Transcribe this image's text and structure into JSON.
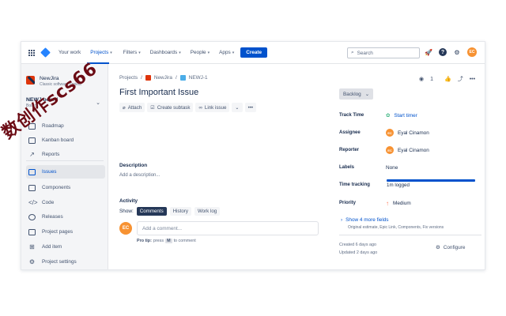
{
  "topnav": {
    "your_work": "Your work",
    "projects": "Projects",
    "filters": "Filters",
    "dashboards": "Dashboards",
    "people": "People",
    "apps": "Apps",
    "create": "Create",
    "search_placeholder": "Search",
    "avatar_initials": "EC"
  },
  "sidebar": {
    "project_name": "NewJira",
    "project_type": "Classic software project",
    "board_name": "NEWJ board",
    "board_type": "Board",
    "items": [
      {
        "label": "Roadmap",
        "icon": "roadmap-icon"
      },
      {
        "label": "Kanban board",
        "icon": "board-icon"
      },
      {
        "label": "Reports",
        "icon": "chart-icon"
      },
      {
        "label": "Issues",
        "icon": "issues-icon"
      },
      {
        "label": "Components",
        "icon": "components-icon"
      },
      {
        "label": "Code",
        "icon": "code-icon"
      },
      {
        "label": "Releases",
        "icon": "ship-icon"
      },
      {
        "label": "Project pages",
        "icon": "page-icon"
      },
      {
        "label": "Add item",
        "icon": "add-item-icon"
      },
      {
        "label": "Project settings",
        "icon": "gear-icon"
      }
    ]
  },
  "main": {
    "breadcrumb_projects": "Projects",
    "breadcrumb_project": "NewJira",
    "breadcrumb_issue": "NEWJ-1",
    "title": "First Important Issue",
    "attach": "Attach",
    "create_subtask": "Create subtask",
    "link_issue": "Link issue",
    "description_label": "Description",
    "description_placeholder": "Add a description...",
    "activity_label": "Activity",
    "show_label": "Show:",
    "show_comments": "Comments",
    "show_history": "History",
    "show_worklog": "Work log",
    "comment_avatar": "EC",
    "comment_placeholder": "Add a comment...",
    "protip_label": "Pro tip:",
    "protip_press": "press",
    "protip_key": "M",
    "protip_rest": "to comment"
  },
  "right": {
    "watchers": "1",
    "status": "Backlog",
    "fields": {
      "track_time_label": "Track Time",
      "track_time_value": "Start timer",
      "assignee_label": "Assignee",
      "assignee_value": "Eyal Cinamon",
      "reporter_label": "Reporter",
      "reporter_value": "Eyal Cinamon",
      "labels_label": "Labels",
      "labels_value": "None",
      "time_tracking_label": "Time tracking",
      "time_tracking_value": "1m logged",
      "priority_label": "Priority",
      "priority_value": "Medium",
      "avatar_initials": "EC"
    },
    "show_more": "Show 4 more fields",
    "show_more_sub": "Original estimate, Epic Link, Components, Fix versions",
    "created": "Created 6 days ago",
    "updated": "Updated 2 days ago",
    "configure": "Configure"
  },
  "watermark": "数创作scs66",
  "colors": {
    "primary": "#0052cc",
    "sidebar_bg": "#f4f5f7",
    "avatar": "#f79232",
    "project_icon": "#de350b",
    "watermark": "#6b0b14"
  }
}
